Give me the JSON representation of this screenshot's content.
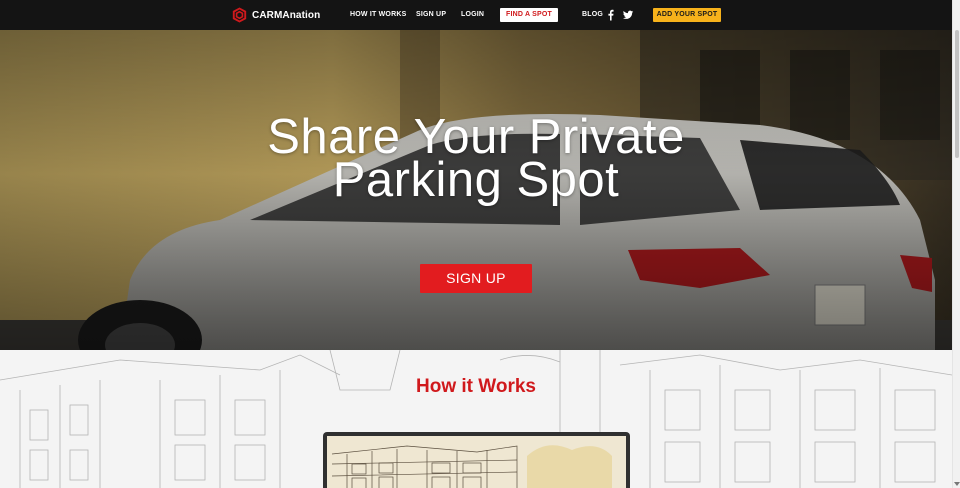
{
  "brand": {
    "name": "CARMAnation",
    "logo_icon": "hexagon-logo-icon",
    "color": "#d0191c"
  },
  "nav": {
    "how_it_works": "HOW IT WORKS",
    "sign_up": "SIGN UP",
    "login": "LOGIN",
    "find_a_spot": "FIND A SPOT",
    "blog": "BLOG",
    "facebook_icon": "facebook-icon",
    "twitter_icon": "twitter-icon",
    "add_your_spot": "ADD YOUR SPOT"
  },
  "hero": {
    "title_line1": "Share Your Private",
    "title_line2": "Parking Spot",
    "cta": "SIGN UP"
  },
  "how_it_works": {
    "title": "How it Works"
  },
  "colors": {
    "nav_bg": "#141414",
    "accent_red": "#e21c1f",
    "accent_yellow": "#f7b21b"
  }
}
